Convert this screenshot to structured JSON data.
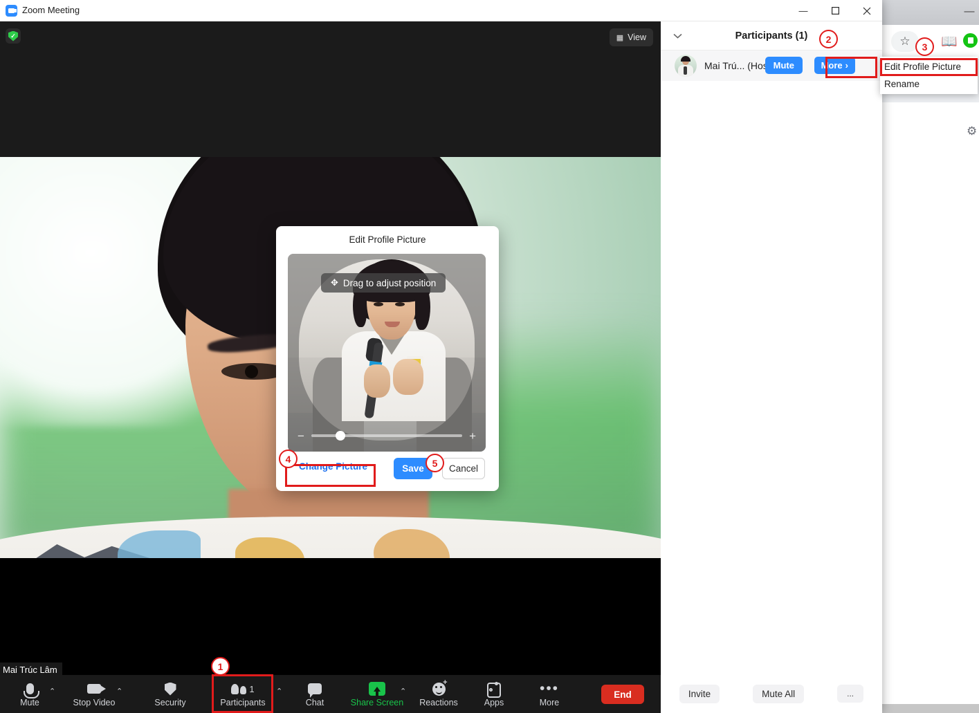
{
  "window": {
    "title": "Zoom Meeting",
    "logo_icon": "zoom-logo-icon",
    "minimize": "—",
    "maximize": "☐",
    "close": "✕"
  },
  "stage": {
    "security_icon": "shield-check-icon",
    "view_icon": "grid-view-icon",
    "view_label": "View",
    "name_badge": "Mai Trúc Lâm"
  },
  "toolbar": {
    "mute": {
      "label": "Mute",
      "icon": "microphone-icon",
      "caret": "⌃"
    },
    "stop_video": {
      "label": "Stop Video",
      "icon": "camera-icon",
      "caret": "⌃"
    },
    "security": {
      "label": "Security",
      "icon": "shield-icon"
    },
    "participants": {
      "label": "Participants",
      "icon": "people-icon",
      "count": "1",
      "caret": "⌃"
    },
    "chat": {
      "label": "Chat",
      "icon": "chat-bubble-icon"
    },
    "share_screen": {
      "label": "Share Screen",
      "icon": "share-screen-icon",
      "caret": "⌃"
    },
    "reactions": {
      "label": "Reactions",
      "icon": "emoji-plus-icon"
    },
    "apps": {
      "label": "Apps",
      "icon": "apps-icon"
    },
    "more": {
      "label": "More",
      "icon": "ellipsis-icon"
    },
    "end": {
      "label": "End"
    }
  },
  "participants_panel": {
    "collapse_icon": "chevron-down-icon",
    "title": "Participants (1)",
    "row": {
      "avatar": "participant-avatar",
      "name": "Mai Trú... (Host, me)",
      "mute_label": "Mute",
      "more_label": "More",
      "more_chevron": "›"
    },
    "footer": {
      "invite": "Invite",
      "mute_all": "Mute All",
      "overflow": "..."
    }
  },
  "context_menu": {
    "items": [
      "Edit Profile Picture",
      "Rename"
    ]
  },
  "edit_profile_dialog": {
    "title": "Edit Profile Picture",
    "drag_hint": "Drag to adjust position",
    "move_icon": "move-cross-icon",
    "zoom_out_icon": "−",
    "zoom_in_icon": "+",
    "slider_value_percent": 16,
    "change_picture": "Change Picture",
    "save": "Save",
    "cancel": "Cancel"
  },
  "background_window": {
    "chevron_icon": "chevron-down-icon",
    "minimize_icon": "—",
    "star_icon": "☆",
    "book_icon": "book-icon",
    "green_icon": "extension-icon",
    "gear_icon": "gear-icon"
  },
  "annotations": [
    {
      "num": "1",
      "target": "participants-toolbar-button"
    },
    {
      "num": "2",
      "target": "participant-more-button"
    },
    {
      "num": "3",
      "target": "edit-profile-picture-menu-item"
    },
    {
      "num": "4",
      "target": "change-picture-link"
    },
    {
      "num": "5",
      "target": "save-button"
    }
  ],
  "colors": {
    "accent_blue": "#2d8cff",
    "end_red": "#d92d20",
    "annotation_red": "#e11b1b",
    "share_green": "#19c34a"
  }
}
